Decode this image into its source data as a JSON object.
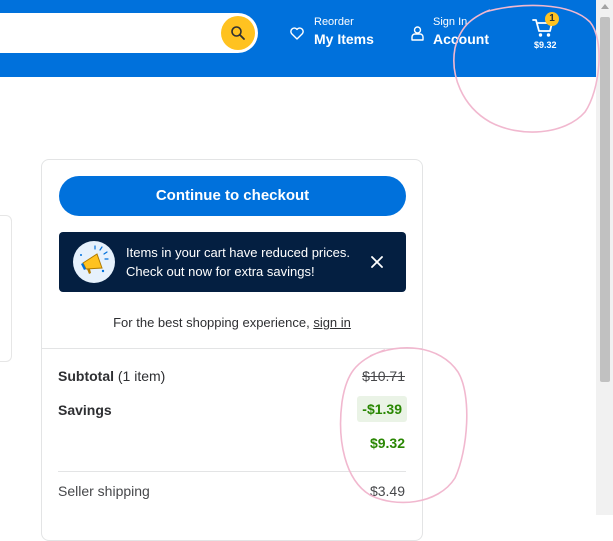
{
  "header": {
    "reorder_small": "Reorder",
    "reorder_big": "My Items",
    "account_small": "Sign In",
    "account_big": "Account",
    "cart_count": "1",
    "cart_total": "$9.32"
  },
  "summary": {
    "checkout_label": "Continue to checkout",
    "promo_line1": "Items in your cart have reduced prices.",
    "promo_line2": "Check out now for extra savings!",
    "signin_prefix": "For the best shopping experience,",
    "signin_link": "sign in",
    "subtotal_label": "Subtotal",
    "subtotal_count": "(1 item)",
    "subtotal_original": "$10.71",
    "savings_label": "Savings",
    "savings_value": "-$1.39",
    "discounted_total": "$9.32",
    "shipping_label": "Seller shipping",
    "shipping_value": "$3.49"
  },
  "colors": {
    "brand_blue": "#0071dc",
    "spark_yellow": "#ffc220",
    "savings_green": "#2a8703",
    "promo_navy": "#041f41",
    "annotation_pink": "#f1b8cf"
  },
  "icons": [
    "search-icon",
    "heart-icon",
    "person-icon",
    "cart-icon",
    "megaphone-icon",
    "close-icon"
  ]
}
